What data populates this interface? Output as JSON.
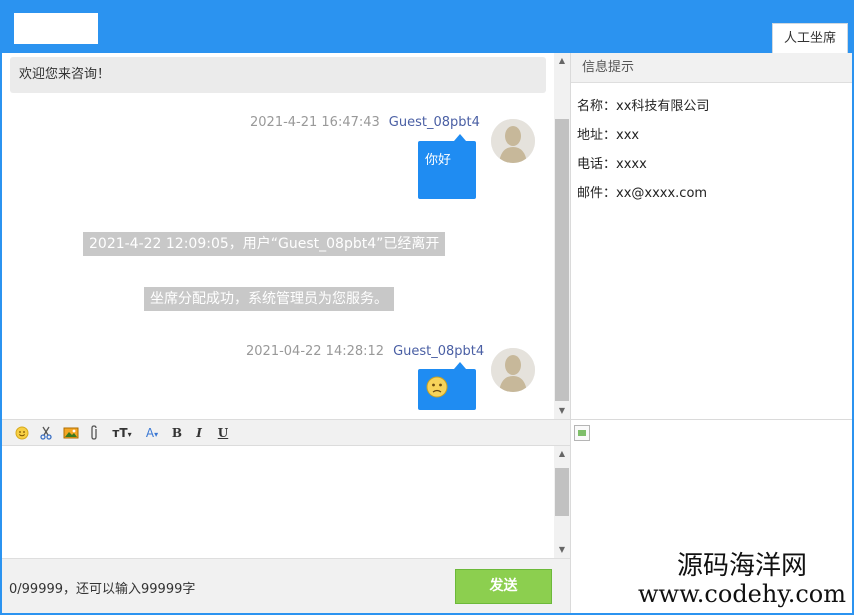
{
  "header": {
    "tab_label": "人工坐席"
  },
  "chat": {
    "welcome": "欢迎您来咨询！",
    "messages": [
      {
        "time": "2021-4-21 16:47:43",
        "user": "Guest_08pbt4",
        "text": "你好"
      },
      {
        "time": "2021-04-22 14:28:12",
        "user": "Guest_08pbt4",
        "text": ""
      }
    ],
    "system_notes": [
      "2021-4-22 12:09:05，用户“Guest_08pbt4”已经离开",
      "坐席分配成功，系统管理员为您服务。"
    ]
  },
  "info_panel": {
    "title": "信息提示",
    "lines": [
      "名称：xx科技有限公司",
      "地址：xxx",
      "电话：xxxx",
      "邮件：xx@xxxx.com"
    ]
  },
  "toolbar": {
    "font_size_label": "тT",
    "font_color_label": "A",
    "bold_label": "B",
    "italic_label": "I",
    "underline_label": "U",
    "icons": [
      "emoji-icon",
      "scissors-icon",
      "image-icon",
      "paperclip-icon",
      "font-size-icon",
      "font-color-icon",
      "bold-icon",
      "italic-icon",
      "underline-icon"
    ]
  },
  "composer": {
    "count_text": "0/99999，还可以输入99999字",
    "send_label": "发送"
  },
  "watermark": {
    "cn": "源码海洋网",
    "url": "www.codehy.com"
  },
  "colors": {
    "brand_blue": "#2b93f0",
    "bubble_blue": "#1f8cf2",
    "send_green": "#8ccf4f"
  }
}
